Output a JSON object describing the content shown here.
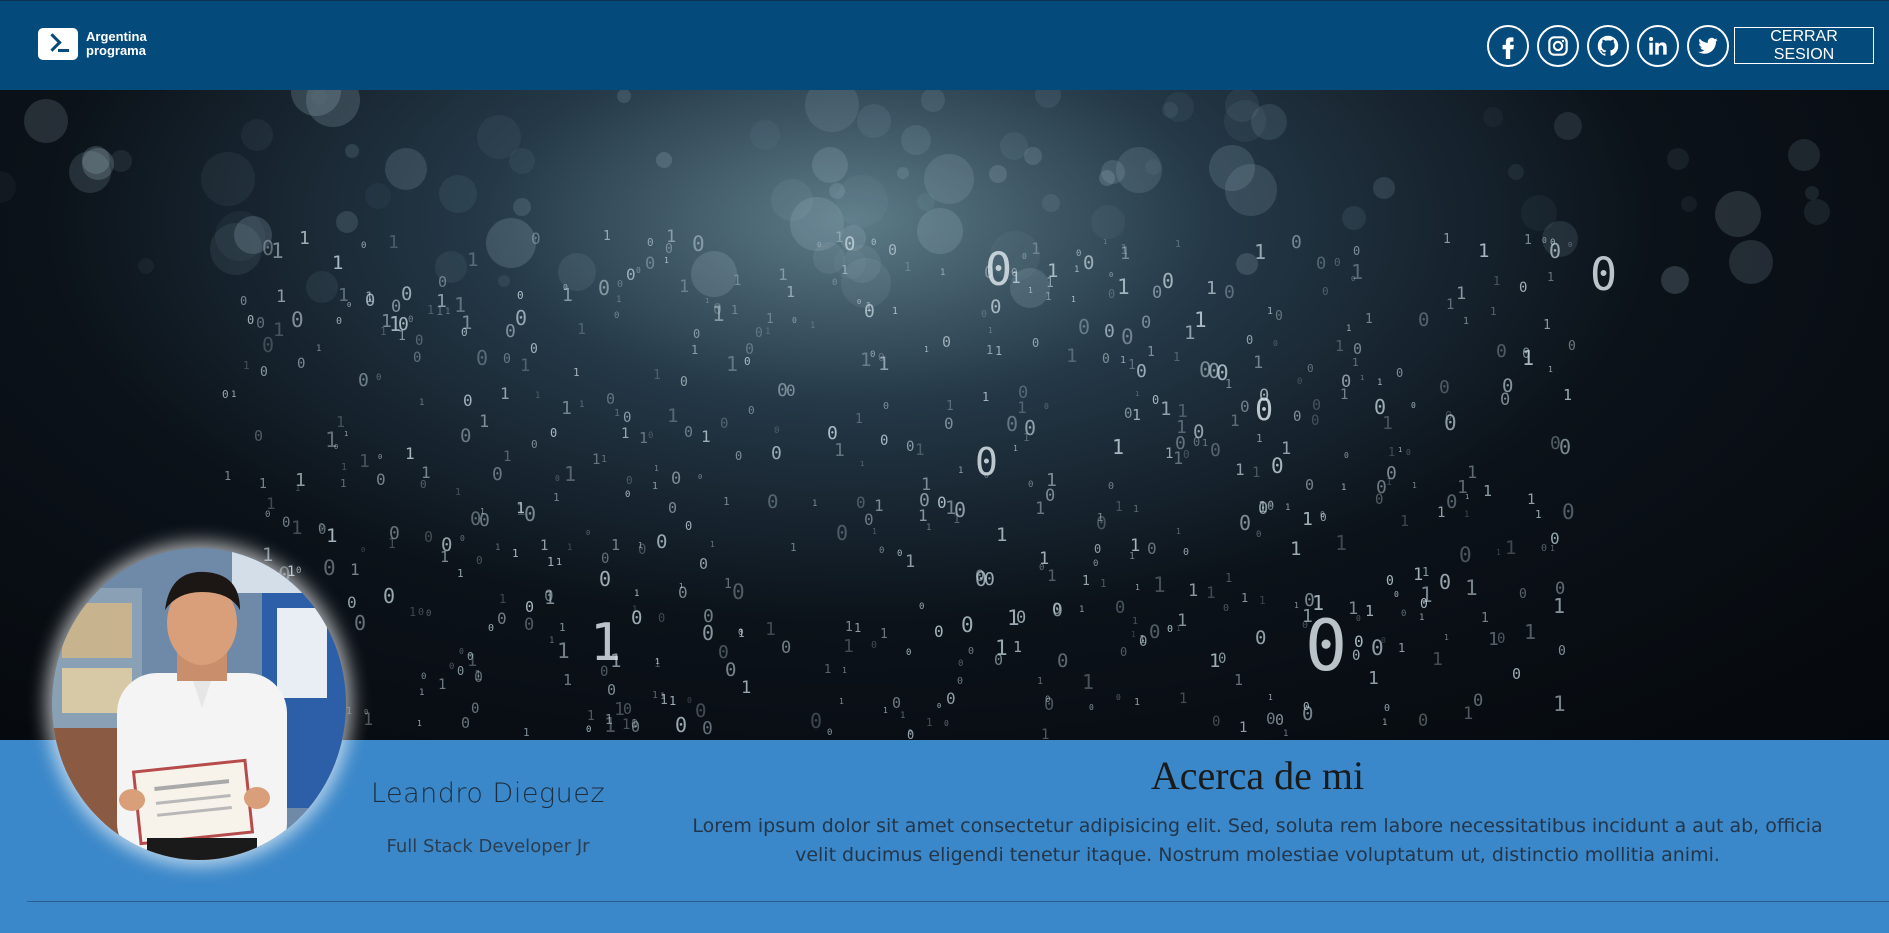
{
  "header": {
    "logo_text_line1": "Argentina",
    "logo_text_line2": "programa",
    "social_icons": [
      "facebook-icon",
      "instagram-icon",
      "github-icon",
      "linkedin-icon",
      "twitter-icon"
    ],
    "logout_label": "CERRAR SESION"
  },
  "profile": {
    "name": "Leandro Dieguez",
    "role": "Full Stack Developer Jr"
  },
  "about": {
    "title": "Acerca de mi",
    "text": "Lorem ipsum dolor sit amet consectetur adipisicing elit. Sed, soluta rem labore necessitatibus incidunt a aut ab, officia velit ducimus eligendi tenetur itaque. Nostrum molestiae voluptatum ut, distinctio mollitia animi."
  },
  "colors": {
    "navbar": "#044a7a",
    "page_background": "#3a87c9",
    "hero_background": "#0b1219"
  }
}
